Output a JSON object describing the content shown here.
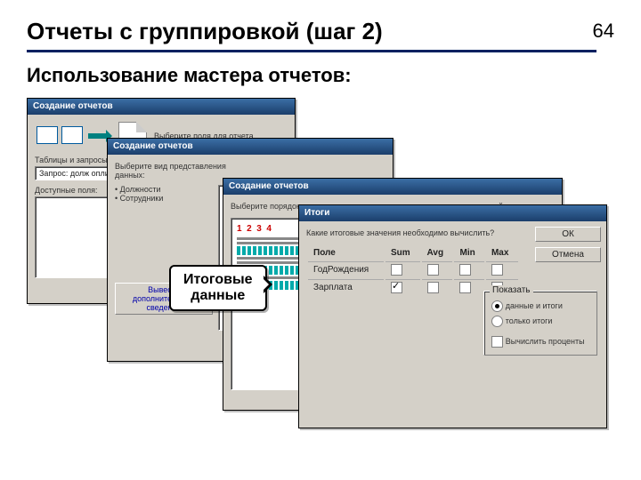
{
  "slide": {
    "title": "Отчеты с группировкой (шаг 2)",
    "page_number": "64",
    "subtitle": "Использование мастера отчетов:"
  },
  "dialogs": {
    "d1": {
      "title": "Создание отчетов",
      "prompt": "Выберите поля для отчета.",
      "labels": {
        "tables_queries": "Таблицы и запросы",
        "source": "Запрос: долж оплиКод",
        "available": "Доступные поля:"
      }
    },
    "d2": {
      "title": "Создание отчетов",
      "prompt": "Выберите вид представления данных:",
      "tree": [
        "• Должности",
        "• Сотрудники"
      ],
      "hint": "Вывести дополнительные сведения"
    },
    "d3": {
      "title": "Создание отчетов",
      "prompt": "Выберите порядок сортировки и вычисления, выполняемые для записей.",
      "numbers": [
        "1",
        "2",
        "3",
        "4"
      ]
    },
    "d4": {
      "title": "Итоги",
      "prompt": "Какие итоговые значения необходимо вычислить?",
      "columns": [
        "Поле",
        "Sum",
        "Avg",
        "Min",
        "Max"
      ],
      "rows": [
        {
          "name": "ГодРождения",
          "sum": false,
          "avg": false,
          "min": false,
          "max": false
        },
        {
          "name": "Зарплата",
          "sum": true,
          "avg": false,
          "min": false,
          "max": false
        }
      ],
      "buttons": {
        "ok": "ОК",
        "cancel": "Отмена"
      },
      "group": {
        "legend": "Показать",
        "opt_data_and_totals": "данные и итоги",
        "opt_totals_only": "только итоги",
        "opt_percent": "Вычислить проценты"
      }
    }
  },
  "callout": {
    "line1": "Итоговые",
    "line2": "данные"
  }
}
